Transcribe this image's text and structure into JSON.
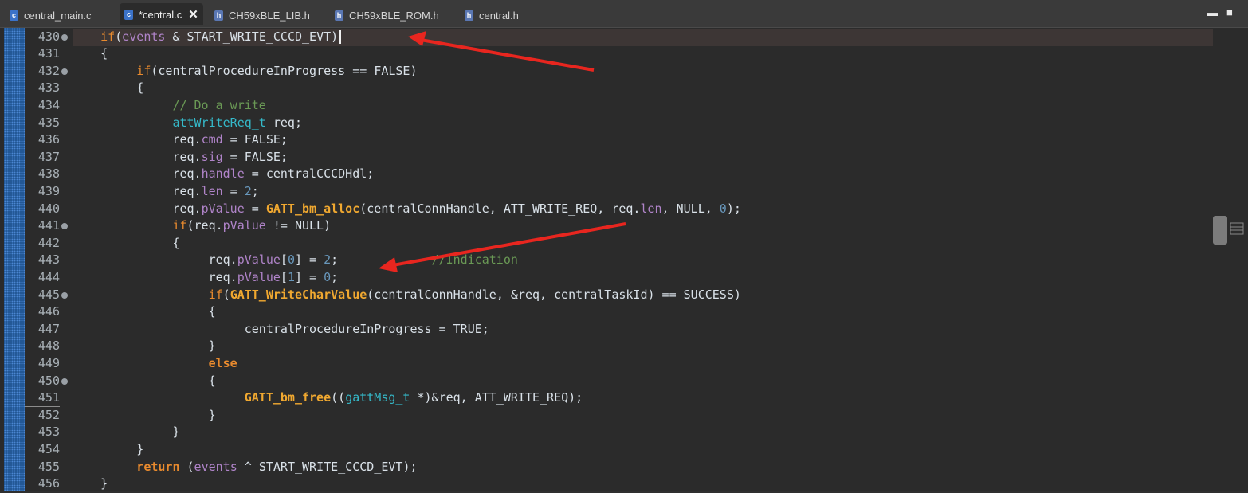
{
  "tabs": [
    {
      "label": "central_main.c",
      "icon": "c-file-icon",
      "active": false
    },
    {
      "label": "*central.c",
      "icon": "c-file-icon",
      "active": true
    },
    {
      "label": "CH59xBLE_LIB.h",
      "icon": "h-file-icon",
      "active": false
    },
    {
      "label": "CH59xBLE_ROM.h",
      "icon": "h-file-icon",
      "active": false
    },
    {
      "label": "central.h",
      "icon": "h-file-icon",
      "active": false
    }
  ],
  "window_controls": {
    "minimize": "▬",
    "maximize": "■"
  },
  "editor": {
    "lines": [
      {
        "num": "430",
        "fold": true
      },
      {
        "num": "431",
        "fold": false
      },
      {
        "num": "432",
        "fold": true
      },
      {
        "num": "433",
        "fold": false
      },
      {
        "num": "434",
        "fold": false
      },
      {
        "num": "435",
        "fold": false
      },
      {
        "num": "436",
        "fold": false
      },
      {
        "num": "437",
        "fold": false
      },
      {
        "num": "438",
        "fold": false
      },
      {
        "num": "439",
        "fold": false
      },
      {
        "num": "440",
        "fold": false
      },
      {
        "num": "441",
        "fold": true
      },
      {
        "num": "442",
        "fold": false
      },
      {
        "num": "443",
        "fold": false
      },
      {
        "num": "444",
        "fold": false
      },
      {
        "num": "445",
        "fold": true
      },
      {
        "num": "446",
        "fold": false
      },
      {
        "num": "447",
        "fold": false
      },
      {
        "num": "448",
        "fold": false
      },
      {
        "num": "449",
        "fold": false
      },
      {
        "num": "450",
        "fold": true
      },
      {
        "num": "451",
        "fold": false
      },
      {
        "num": "452",
        "fold": false
      },
      {
        "num": "453",
        "fold": false
      },
      {
        "num": "454",
        "fold": false
      },
      {
        "num": "455",
        "fold": false
      },
      {
        "num": "456",
        "fold": false
      }
    ],
    "code_text": {
      "l430": [
        "if",
        "(",
        "events",
        " & ",
        "START_WRITE_CCCD_EVT",
        ")"
      ],
      "l431": "{",
      "l432": [
        "if",
        "(centralProcedureInProgress == FALSE)"
      ],
      "l433": "{",
      "l434": "// Do a write",
      "l435": [
        "attWriteReq_t",
        " req;"
      ],
      "l436": [
        "req.",
        "cmd",
        " = FALSE;"
      ],
      "l437": [
        "req.",
        "sig",
        " = FALSE;"
      ],
      "l438": [
        "req.",
        "handle",
        " = centralCCCDHdl;"
      ],
      "l439": [
        "req.",
        "len",
        " = ",
        "2",
        ";"
      ],
      "l440": [
        "req.",
        "pValue",
        " = ",
        "GATT_bm_alloc",
        "(centralConnHandle, ATT_WRITE_REQ, req.",
        "len",
        ", NULL, ",
        "0",
        ");"
      ],
      "l441": [
        "if",
        "(req.",
        "pValue",
        " != NULL)"
      ],
      "l442": "{",
      "l443": [
        "req.",
        "pValue",
        "[",
        "0",
        "] = ",
        "2",
        ";",
        "//Indication"
      ],
      "l444": [
        "req.",
        "pValue",
        "[",
        "1",
        "] = ",
        "0",
        ";"
      ],
      "l445": [
        "if",
        "(",
        "GATT_WriteCharValue",
        "(centralConnHandle, &req, centralTaskId) == SUCCESS)"
      ],
      "l446": "{",
      "l447": "centralProcedureInProgress = TRUE;",
      "l448": "}",
      "l449": "else",
      "l450": "{",
      "l451": [
        "GATT_bm_free",
        "((",
        "gattMsg_t",
        " *)&req, ATT_WRITE_REQ);"
      ],
      "l452": "}",
      "l453": "}",
      "l454": "}",
      "l455": [
        "return",
        " (",
        "events",
        " ^ START_WRITE_CCCD_EVT);"
      ],
      "l456": "}"
    }
  },
  "colors": {
    "keyword": "#e88a2e",
    "function": "#f0a830",
    "type": "#35b9c9",
    "field": "#b084c9",
    "number": "#6897bb",
    "comment": "#6a9955",
    "annotation_arrow": "#e8261f"
  }
}
